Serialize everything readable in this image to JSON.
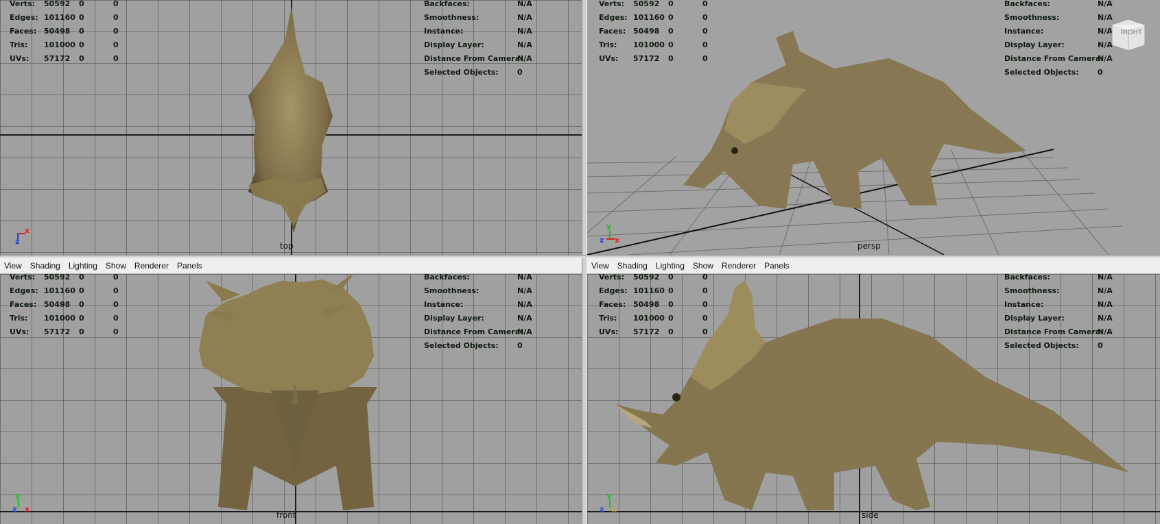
{
  "menu": {
    "items": [
      "View",
      "Shading",
      "Lighting",
      "Show",
      "Renderer",
      "Panels"
    ]
  },
  "hud_left": [
    {
      "label": "Verts:",
      "v1": "50592",
      "v2": "0",
      "v3": "0"
    },
    {
      "label": "Edges:",
      "v1": "101160",
      "v2": "0",
      "v3": "0"
    },
    {
      "label": "Faces:",
      "v1": "50498",
      "v2": "0",
      "v3": "0"
    },
    {
      "label": "Tris:",
      "v1": "101000",
      "v2": "0",
      "v3": "0"
    },
    {
      "label": "UVs:",
      "v1": "57172",
      "v2": "0",
      "v3": "0"
    }
  ],
  "hud_right": [
    {
      "label": "Backfaces:",
      "value": "N/A"
    },
    {
      "label": "Smoothness:",
      "value": "N/A"
    },
    {
      "label": "Instance:",
      "value": "N/A"
    },
    {
      "label": "Display Layer:",
      "value": "N/A"
    },
    {
      "label": "Distance From Camera:",
      "value": "N/A"
    },
    {
      "label": "Selected Objects:",
      "value": "0"
    }
  ],
  "viewports": {
    "top": {
      "camera": "top"
    },
    "persp": {
      "camera": "persp"
    },
    "front": {
      "camera": "front"
    },
    "side": {
      "camera": "side"
    }
  },
  "gizmo": {
    "x": "x",
    "y": "y",
    "z": "z"
  },
  "viewcube": {
    "label": "RIGHT"
  },
  "colors": {
    "viewport_bg": "#a0a0a0",
    "hud_text": "#0f1a0f",
    "dino_skin": "#8a7a52",
    "axis_x": "#e02020",
    "axis_y": "#20c020",
    "axis_z": "#2040e0"
  }
}
